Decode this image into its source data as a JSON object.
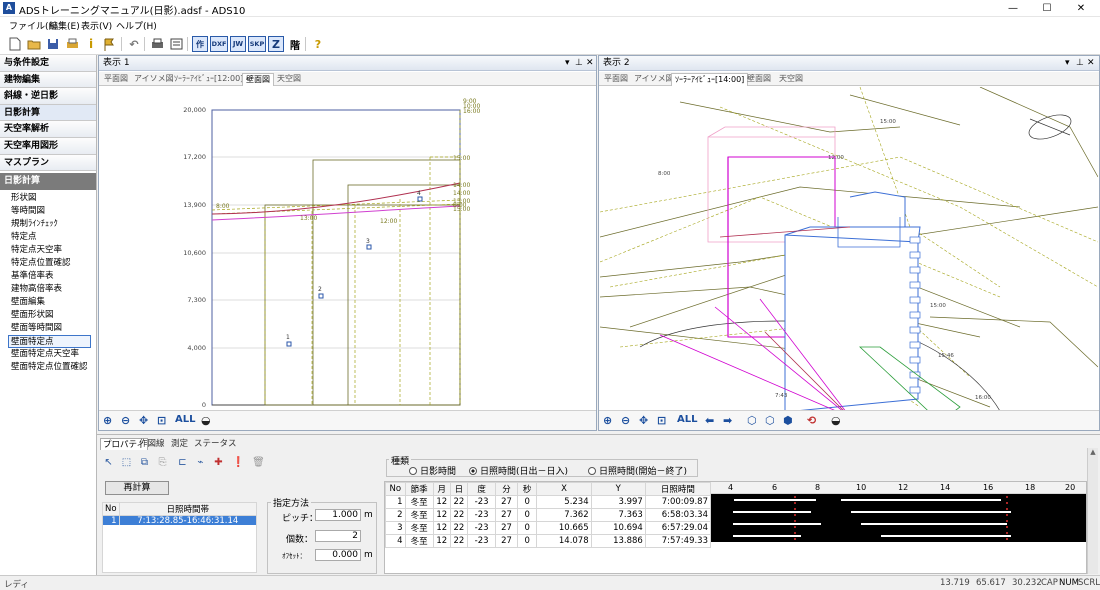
{
  "window": {
    "title": "ADSトレーニングマニュアル(日影).adsf - ADS10",
    "min": "—",
    "max": "☐",
    "close": "✕"
  },
  "menu": [
    "ファイル(F)",
    "編集(E)",
    "表示(V)",
    "ヘルプ(H)"
  ],
  "toolbar": {
    "labels": [
      "作",
      "DXF",
      "JW",
      "SKP",
      "Z",
      "階",
      "?"
    ]
  },
  "sidebar": {
    "categories": [
      "与条件設定",
      "建物編集",
      "斜線・逆日影",
      "日影計算",
      "天空率解析",
      "天空率用図形",
      "マスプラン"
    ],
    "active_category": "日影計算",
    "section": "日影計算",
    "items": [
      "形状図",
      "等時間図",
      "規制ﾗｲﾝﾁｪｯｸ",
      "特定点",
      "特定点天空率",
      "特定点位置確認",
      "基準倍率表",
      "建物高倍率表",
      "壁面編集",
      "壁面形状図",
      "壁面等時間図",
      "壁面特定点",
      "壁面特定点天空率",
      "壁面特定点位置確認"
    ],
    "selected_item": "壁面特定点"
  },
  "pane1": {
    "title": "表示 1",
    "tabs": [
      "平面図",
      "アイソメ図",
      "ｿｰﾗｰｱｲﾋﾞｭｰ[12:00]",
      "壁面図",
      "天空図"
    ],
    "active": "壁面図",
    "yticks": [
      "20,000",
      "17,200",
      "13,900",
      "10,600",
      "7,300",
      "4,000",
      "0"
    ],
    "time_labels": [
      "8:00",
      "9:00",
      "10:00",
      "16:00",
      "15:00",
      "14:00",
      "14:00",
      "13:00",
      "12:00",
      "13:00",
      "8:00",
      "15:00"
    ],
    "points": [
      "1",
      "2",
      "3",
      "4"
    ]
  },
  "pane2": {
    "title": "表示 2",
    "tabs": [
      "平面図",
      "アイソメ図",
      "ｿｰﾗｰｱｲﾋﾞｭｰ[14:00]",
      "壁面図",
      "天空図"
    ],
    "active": "ｿｰﾗｰｱｲﾋﾞｭｰ[14:00]",
    "labels": [
      "15:00",
      "12:00",
      "8:00",
      "15:00",
      "15:46",
      "7:43",
      "16:00"
    ]
  },
  "nav": {
    "all": "ALL"
  },
  "bottom": {
    "tabs": [
      "プロパティ",
      "作図線",
      "測定",
      "ステータス"
    ],
    "active": "プロパティ",
    "recalc": "再計算",
    "times_table": {
      "headers": [
        "No",
        "日照時間帯"
      ],
      "rows": [
        [
          "1",
          "7:13:28.85-16:46:31.14"
        ]
      ]
    },
    "method": {
      "title": "指定方法",
      "pitch_label": "ピッチ：",
      "pitch": "1.000",
      "pitch_unit": "m",
      "count_label": "個数：",
      "count": "2",
      "offset_label": "ｵﾌｾｯﾄ：",
      "offset": "0.000",
      "offset_unit": "m"
    },
    "kind": {
      "title": "種類",
      "options": [
        "日影時間",
        "日照時間(日出－日入)",
        "日照時間(開始－終了)"
      ],
      "selected": 1
    },
    "result": {
      "headers": [
        "No",
        "節季",
        "月",
        "日",
        "度",
        "分",
        "秒",
        "X",
        "Y",
        "日照時間"
      ],
      "rows": [
        [
          "1",
          "冬至",
          "12",
          "22",
          "-23",
          "27",
          "0",
          "5.234",
          "3.997",
          "7:00:09.87"
        ],
        [
          "2",
          "冬至",
          "12",
          "22",
          "-23",
          "27",
          "0",
          "7.362",
          "7.363",
          "6:58:03.34"
        ],
        [
          "3",
          "冬至",
          "12",
          "22",
          "-23",
          "27",
          "0",
          "10.665",
          "10.694",
          "6:57:29.04"
        ],
        [
          "4",
          "冬至",
          "12",
          "22",
          "-23",
          "27",
          "0",
          "14.078",
          "13.886",
          "7:57:49.33"
        ]
      ],
      "hours": [
        "4",
        "6",
        "8",
        "10",
        "12",
        "14",
        "16",
        "18",
        "20"
      ]
    }
  },
  "status": {
    "left": "レディ",
    "x": "13.719",
    "y": "65.617",
    "z": "30.232",
    "cap": "CAP",
    "num": "NUM",
    "scrl": "SCRL"
  }
}
